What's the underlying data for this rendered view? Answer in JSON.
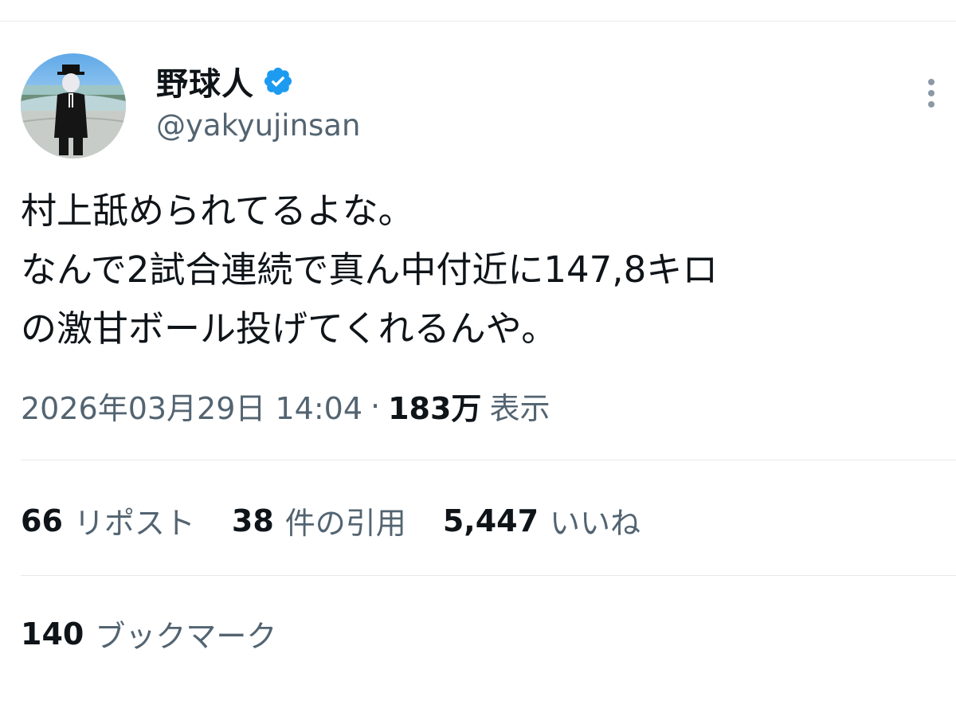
{
  "author": {
    "display_name": "野球人",
    "handle": "@yakyujinsan",
    "verified_color": "#1d9bf0"
  },
  "icons": {
    "verified": "verified-badge-icon",
    "more": "more-vertical-icon"
  },
  "tweet": {
    "lines": [
      "村上舐められてるよな。",
      "なんで2試合連続で真ん中付近に147,8キロ",
      "の激甘ボール投げてくれるんや。"
    ]
  },
  "meta": {
    "timestamp": "2026年03月29日 14:04",
    "separator": "·",
    "views_count": "183万",
    "views_label": "表示"
  },
  "stats": {
    "reposts": {
      "count": "66",
      "label": "リポスト"
    },
    "quotes": {
      "count": "38",
      "label": "件の引用"
    },
    "likes": {
      "count": "5,447",
      "label": "いいね"
    },
    "bookmarks": {
      "count": "140",
      "label": "ブックマーク"
    }
  },
  "colors": {
    "text_primary": "#0f1419",
    "text_secondary": "#536471",
    "divider": "#e7e9ea"
  }
}
